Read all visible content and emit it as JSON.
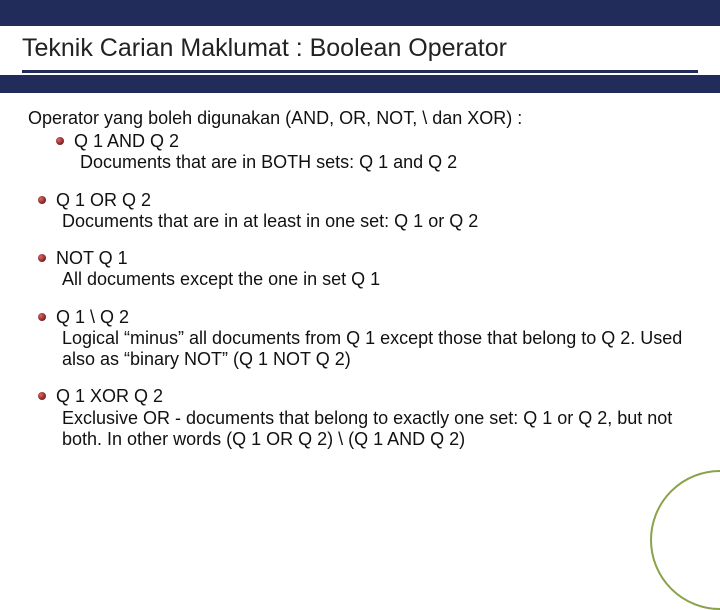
{
  "title": "Teknik Carian Maklumat : Boolean Operator",
  "intro": "Operator yang boleh digunakan (AND, OR, NOT, \\ dan XOR) :",
  "first": {
    "title": "Q 1 AND Q 2",
    "desc": "Documents that are in BOTH sets: Q 1 and Q 2"
  },
  "ops": [
    {
      "title": "Q 1 OR Q 2",
      "desc": "Documents that are in at least in one set: Q 1 or Q 2"
    },
    {
      "title": "NOT Q 1",
      "desc": "All documents except the one in set Q 1"
    },
    {
      "title": "Q 1 \\ Q 2",
      "desc": "Logical “minus” all documents from Q 1 except those that belong to Q 2. Used also as “binary NOT” (Q 1 NOT Q 2)"
    },
    {
      "title": "Q 1 XOR Q 2",
      "desc": "Exclusive OR - documents that belong to exactly one set: Q 1 or Q 2, but not both. In other words (Q 1 OR Q 2) \\ (Q 1 AND Q 2)"
    }
  ]
}
